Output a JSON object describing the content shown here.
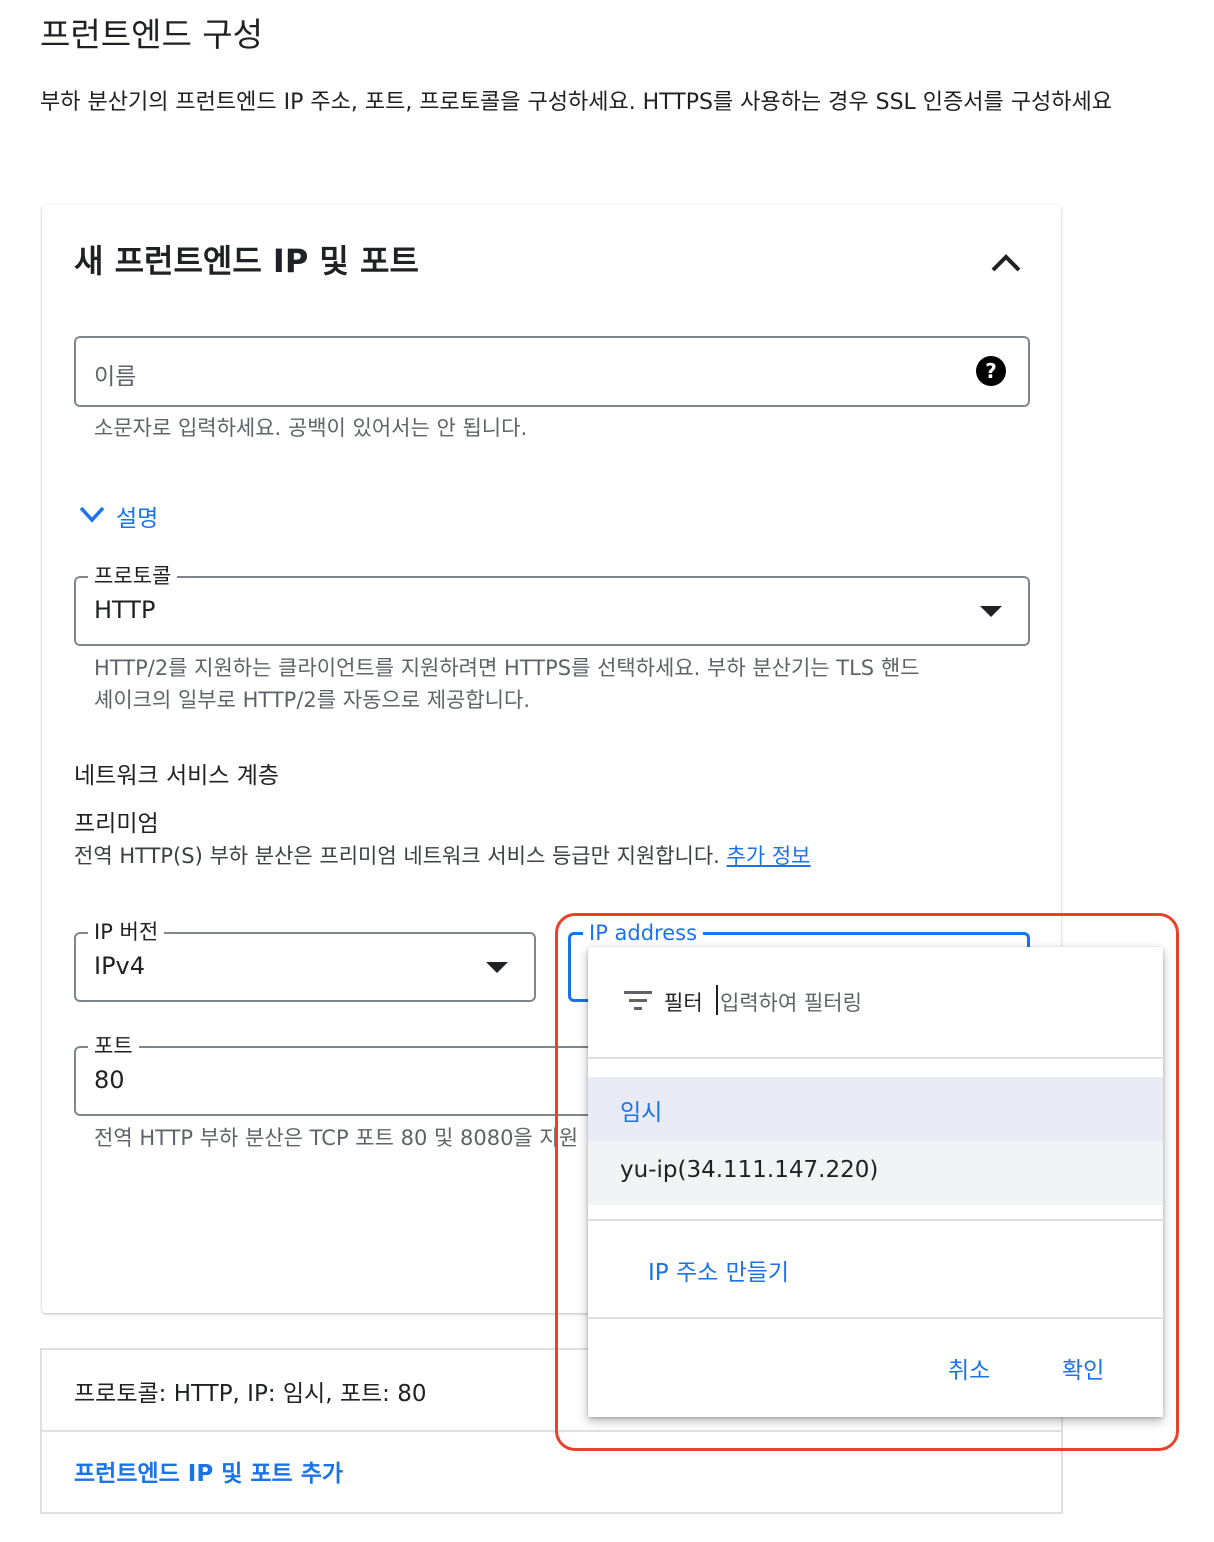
{
  "page": {
    "title": "프런트엔드 구성",
    "description": "부하 분산기의 프런트엔드 IP 주소, 포트, 프로토콜을 구성하세요. HTTPS를 사용하는 경우 SSL 인증서를 구성하세요"
  },
  "card": {
    "title": "새 프런트엔드 IP 및 포트",
    "collapse_icon": "chevron-up-icon"
  },
  "name_field": {
    "placeholder": "이름",
    "help_icon": "help-icon",
    "hint": "소문자로 입력하세요. 공백이 있어서는 안 됩니다."
  },
  "description_toggle": {
    "label": "설명",
    "icon": "chevron-down-icon"
  },
  "protocol_field": {
    "label": "프로토콜",
    "value": "HTTP",
    "hint_line1": "HTTP/2를 지원하는 클라이언트를 지원하려면 HTTPS를 선택하세요. 부하 분산기는 TLS 핸드",
    "hint_line2": "셰이크의 일부로 HTTP/2를 자동으로 제공합니다."
  },
  "network_tier": {
    "heading": "네트워크 서비스 계층",
    "value": "프리미엄",
    "note": "전역 HTTP(S) 부하 분산은 프리미엄 네트워크 서비스 등급만 지원합니다.",
    "link": "추가 정보"
  },
  "ip_version_field": {
    "label": "IP 버전",
    "value": "IPv4"
  },
  "ip_address_field": {
    "label": "IP address"
  },
  "port_field": {
    "label": "포트",
    "value": "80",
    "hint": "전역 HTTP 부하 분산은 TCP 포트 80 및 8080을 지원"
  },
  "dropdown": {
    "filter_icon": "filter-icon",
    "filter_label": "필터",
    "filter_placeholder": "입력하여 필터링",
    "options": [
      "임시",
      "yu-ip(34.111.147.220)"
    ],
    "create_label": "IP 주소 만들기",
    "cancel_label": "취소",
    "ok_label": "확인"
  },
  "summary": {
    "text": "프로토콜: HTTP, IP: 임시, 포트: 80",
    "add_link": "프런트엔드 IP 및 포트 추가"
  },
  "colors": {
    "accent": "#1a73e8",
    "highlight": "#e8422c",
    "selected_bg": "#e8eaf6"
  }
}
